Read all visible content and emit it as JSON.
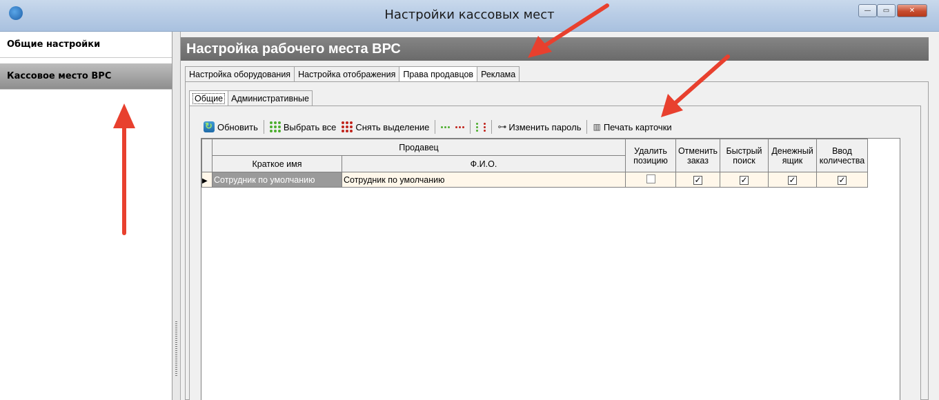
{
  "window": {
    "title": "Настройки кассовых мест",
    "close_label": "✕",
    "maximize_label": "▭",
    "minimize_label": "—"
  },
  "sidebar": {
    "items": [
      {
        "label": "Общие настройки"
      },
      {
        "label": "Кассовое место ВРС"
      }
    ]
  },
  "header": {
    "title": "Настройка рабочего места ВРС"
  },
  "tabs": [
    {
      "label": "Настройка оборудования"
    },
    {
      "label": "Настройка отображения"
    },
    {
      "label": "Права продавцов"
    },
    {
      "label": "Реклама"
    }
  ],
  "subtabs": [
    {
      "label": "Общие"
    },
    {
      "label": "Административные"
    }
  ],
  "toolbar": {
    "refresh": "Обновить",
    "select_all": "Выбрать все",
    "deselect": "Снять выделение",
    "change_password": "Изменить пароль",
    "print_card": "Печать карточки"
  },
  "grid": {
    "group_header": "Продавец",
    "columns": {
      "short": "Краткое имя",
      "full": "Ф.И.О.",
      "del": "Удалить позицию",
      "cancel": "Отменить заказ",
      "search": "Быстрый поиск",
      "drawer": "Денежный ящик",
      "qty": "Ввод количества"
    },
    "rows": [
      {
        "short": "Сотрудник по умолчанию",
        "full": "Сотрудник по умолчанию",
        "del": false,
        "cancel": true,
        "search": true,
        "drawer": true,
        "qty": true
      }
    ]
  },
  "colors": {
    "annotation_arrow": "#e8402e",
    "header_bg": "#7a7a7a",
    "row_bg": "#fff7ea"
  }
}
